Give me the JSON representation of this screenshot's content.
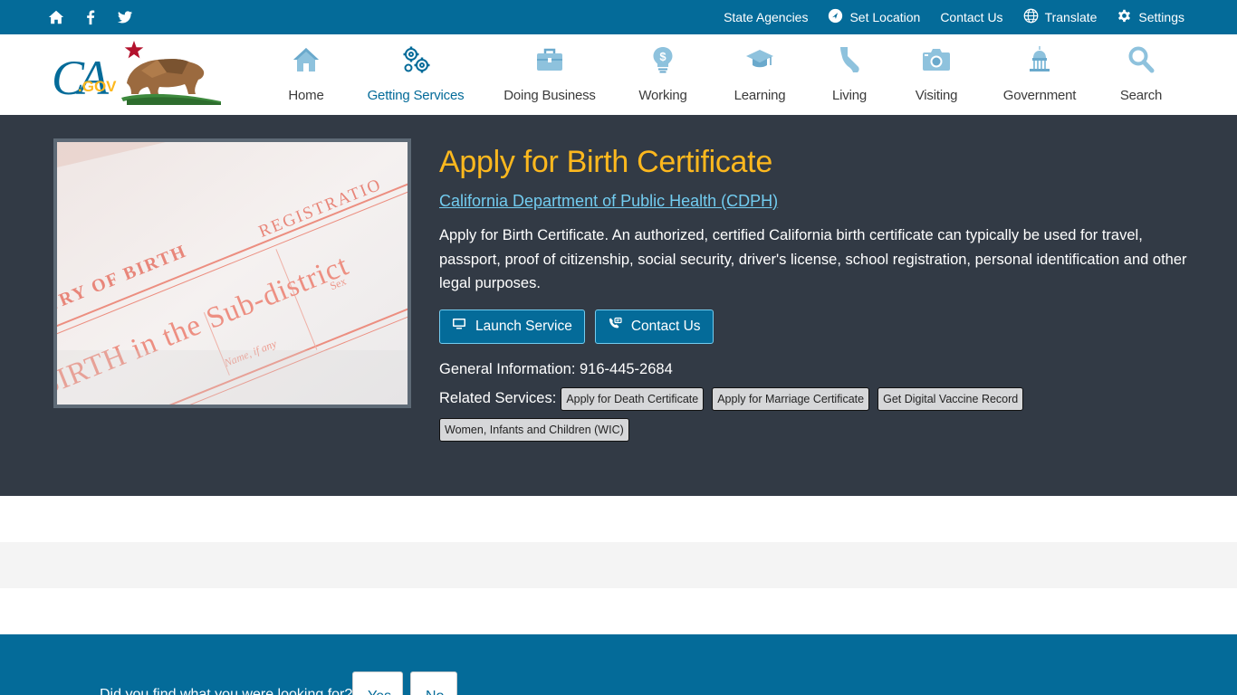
{
  "utility": {
    "home_icon": "home-icon",
    "facebook_icon": "facebook-icon",
    "twitter_icon": "twitter-icon",
    "links": {
      "state_agencies": "State Agencies",
      "set_location": "Set Location",
      "contact_us": "Contact Us",
      "translate": "Translate",
      "settings": "Settings"
    }
  },
  "logo": {
    "text": "CA.GOV"
  },
  "nav": {
    "home": "Home",
    "getting_services": "Getting Services",
    "doing_business": "Doing Business",
    "working": "Working",
    "learning": "Learning",
    "living": "Living",
    "visiting": "Visiting",
    "government": "Government",
    "search": "Search"
  },
  "service": {
    "title": "Apply for Birth Certificate",
    "department": "California Department of Public Health (CDPH)",
    "description": "Apply for Birth Certificate. An authorized, certified California birth certificate can typically be used for travel, passport, proof of citizenship, social security, driver's license, school registration, personal identification and other legal purposes.",
    "launch_label": "Launch Service",
    "contact_label": "Contact Us",
    "general_info": "General Information: 916-445-2684",
    "related_label": "Related Services:",
    "related": [
      "Apply for Death Certificate",
      "Apply for Marriage Certificate",
      "Get Digital Vaccine Record",
      "Women, Infants and Children (WIC)"
    ]
  },
  "photo": {
    "line1": "ENTRY OF BIRTH",
    "line2": "REGISTRATIO",
    "line3": "BIRTH in the Sub-district",
    "line4": "Name, if any",
    "line5": "Sex"
  },
  "feedback": {
    "question": "Did you find what you were looking for?",
    "yes": "Yes",
    "no": "No"
  },
  "colors": {
    "primary": "#046b99",
    "hero_bg": "#323a45",
    "title": "#fdb81e",
    "link": "#72ccf0"
  }
}
